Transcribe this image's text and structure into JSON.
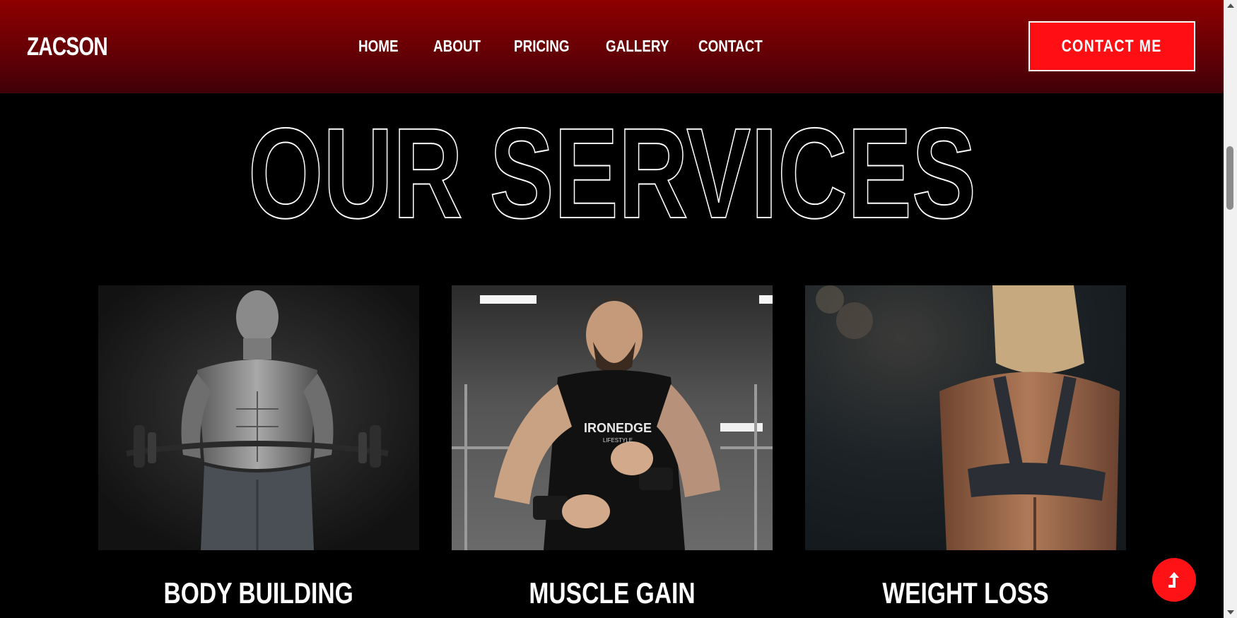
{
  "header": {
    "logo": "ZACSON",
    "nav": [
      "HOME",
      "ABOUT",
      "PRICING",
      "GALLERY",
      "CONTACT"
    ],
    "cta_label": "CONTACT ME"
  },
  "services": {
    "title": "OUR SERVICES",
    "cards": [
      {
        "title": "BODY BUILDING",
        "image": "bodybuilder-barbell-photo"
      },
      {
        "title": "MUSCLE GAIN",
        "image": "man-wrist-wraps-gym-photo"
      },
      {
        "title": "WEIGHT LOSS",
        "image": "woman-back-muscles-photo"
      }
    ]
  },
  "fab": {
    "icon": "arrow-up-icon"
  },
  "colors": {
    "accent": "#ff0f13",
    "header_dark": "#5a0006",
    "background": "#000000"
  }
}
